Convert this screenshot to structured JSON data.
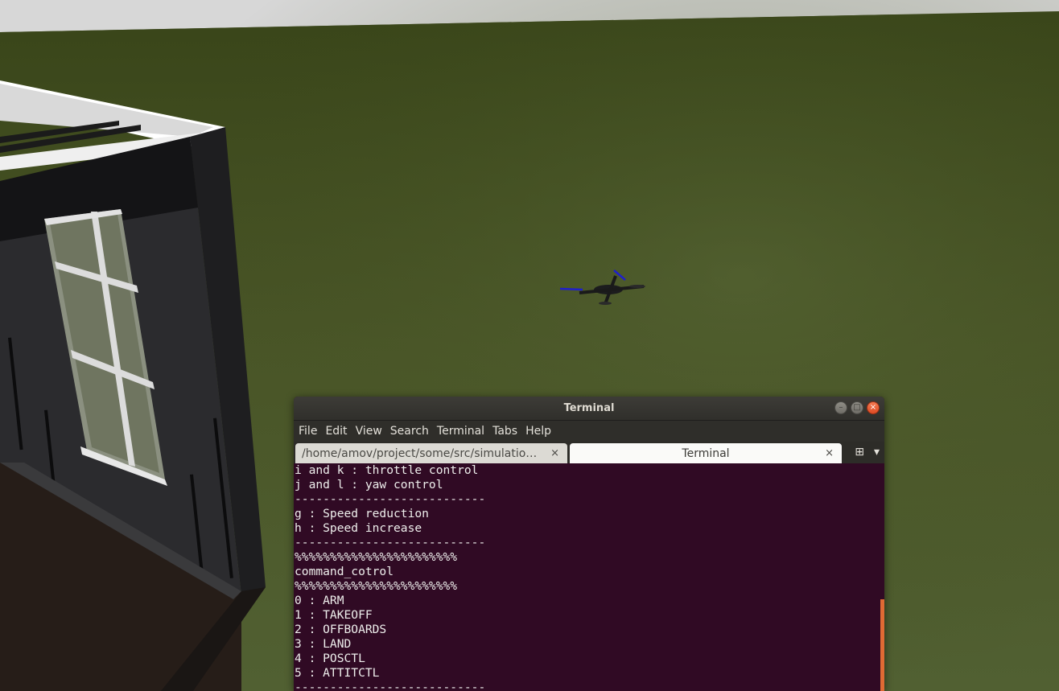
{
  "terminal": {
    "title": "Terminal",
    "menu": [
      "File",
      "Edit",
      "View",
      "Search",
      "Terminal",
      "Tabs",
      "Help"
    ],
    "tabs": [
      {
        "label": "/home/amov/project/some/src/simulatio…",
        "active": false
      },
      {
        "label": "Terminal",
        "active": true
      }
    ],
    "close_glyph": "×",
    "new_tab_glyph": "⊞",
    "dropdown_glyph": "▾",
    "lines": [
      "i and k : throttle control",
      "j and l : yaw control",
      "---------------------------",
      "g : Speed reduction",
      "h : Speed increase",
      "---------------------------",
      "%%%%%%%%%%%%%%%%%%%%%%%",
      "command_cotrol",
      "%%%%%%%%%%%%%%%%%%%%%%%",
      "0 : ARM",
      "1 : TAKEOFF",
      "2 : OFFBOARDS",
      "3 : LAND",
      "4 : POSCTL",
      "5 : ATTITCTL",
      "---------------------------"
    ],
    "colors": {
      "background": "#300a24",
      "text": "#eeeeec",
      "scrollbar": "#e06a34",
      "close_button": "#e6562b"
    }
  },
  "scene": {
    "description_icons": [
      "house-model",
      "quadcopter-drone"
    ],
    "colors": {
      "ground": "#4a5528",
      "sky": "#d8d8d8",
      "building": "#2a2a2d",
      "drone_props": "#1f1fcc"
    }
  }
}
